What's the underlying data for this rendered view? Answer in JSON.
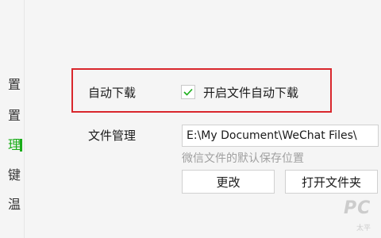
{
  "sidebar": {
    "items": [
      {
        "label": "置"
      },
      {
        "label": "置"
      },
      {
        "label": "理"
      },
      {
        "label": "键"
      },
      {
        "label": "温"
      }
    ]
  },
  "auto_download": {
    "label": "自动下载",
    "checkbox_label": "开启文件自动下载",
    "checked": true
  },
  "file_management": {
    "label": "文件管理",
    "path_value": "E:\\My Document\\WeChat Files\\",
    "hint": "微信文件的默认保存位置",
    "change_button": "更改",
    "open_folder_button": "打开文件夹"
  },
  "watermark": {
    "main": "PC",
    "sub": "太平"
  },
  "colors": {
    "accent_green": "#1aad19",
    "highlight_red": "#d9272d",
    "check_green": "#1aad19"
  }
}
